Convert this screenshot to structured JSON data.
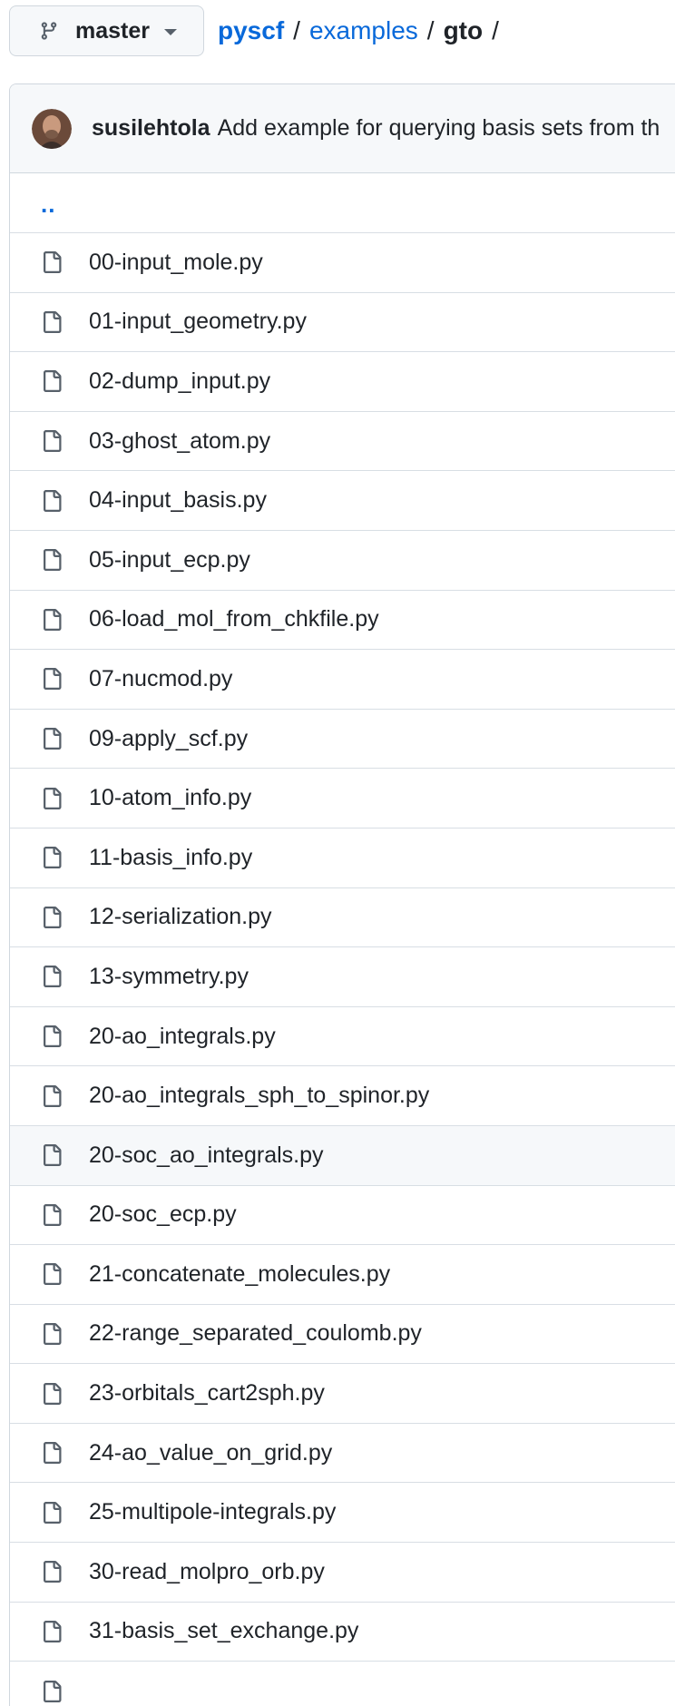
{
  "branch": {
    "name": "master",
    "branch_icon": "git-branch-icon",
    "caret_icon": "triangle-down-icon"
  },
  "breadcrumb": {
    "root": "pyscf",
    "parts": [
      "examples"
    ],
    "current": "gto",
    "separator": "/"
  },
  "commit": {
    "author": "susilehtola",
    "message": "Add example for querying basis sets from th"
  },
  "parent_dir": "..",
  "files": [
    "00-input_mole.py",
    "01-input_geometry.py",
    "02-dump_input.py",
    "03-ghost_atom.py",
    "04-input_basis.py",
    "05-input_ecp.py",
    "06-load_mol_from_chkfile.py",
    "07-nucmod.py",
    "09-apply_scf.py",
    "10-atom_info.py",
    "11-basis_info.py",
    "12-serialization.py",
    "13-symmetry.py",
    "20-ao_integrals.py",
    "20-ao_integrals_sph_to_spinor.py",
    "20-soc_ao_integrals.py",
    "20-soc_ecp.py",
    "21-concatenate_molecules.py",
    "22-range_separated_coulomb.py",
    "23-orbitals_cart2sph.py",
    "24-ao_value_on_grid.py",
    "25-multipole-integrals.py",
    "30-read_molpro_orb.py",
    "31-basis_set_exchange.py",
    ""
  ],
  "highlighted_file": "20-soc_ao_integrals.py",
  "file_icon": "file-icon",
  "colors": {
    "link": "#0969da",
    "border": "#d0d7de",
    "header_bg": "#f6f8fa",
    "text": "#1f2328"
  }
}
